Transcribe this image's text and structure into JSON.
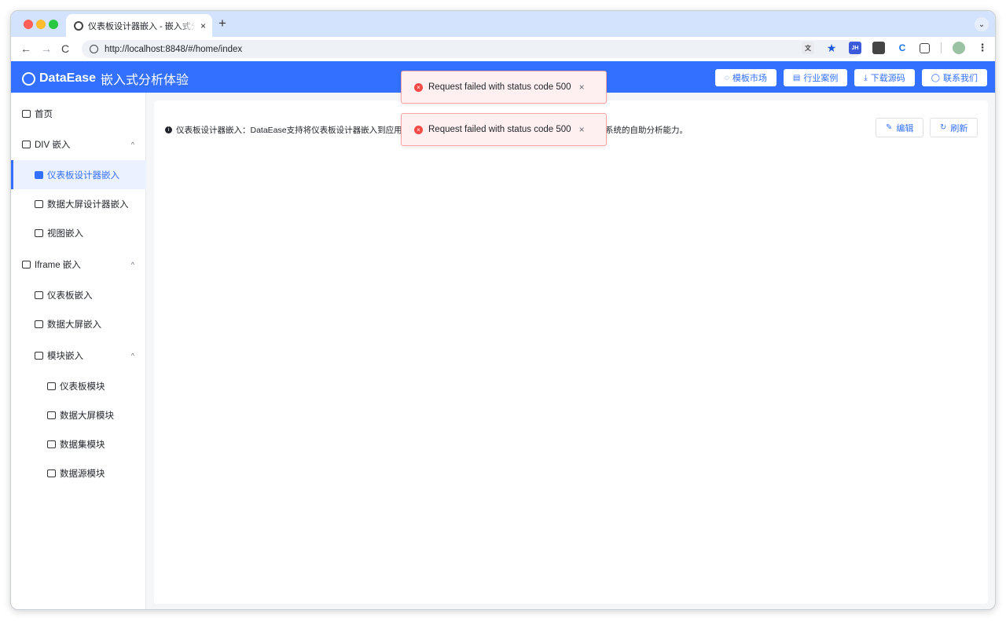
{
  "browser": {
    "tab_title": "仪表板设计器嵌入 - 嵌入式分析体验",
    "tab_close": "×",
    "new_tab": "+",
    "tab_menu": "⌄",
    "nav_back": "←",
    "nav_forward": "→",
    "nav_reload": "C",
    "url": "http://localhost:8848/#/home/index",
    "ext_jh": "JH",
    "ext_c": "C",
    "star": "★",
    "more": "⋮"
  },
  "header": {
    "brand_name": "DataEase",
    "brand_sub": "嵌入式分析体验",
    "buttons": [
      {
        "label": "模板市场",
        "icon": "thumb-icon"
      },
      {
        "label": "行业案例",
        "icon": "document-icon"
      },
      {
        "label": "下载源码",
        "icon": "download-icon"
      },
      {
        "label": "联系我们",
        "icon": "chat-icon"
      }
    ],
    "accent": "#3370ff"
  },
  "sidebar": {
    "items": [
      {
        "label": "首页"
      },
      {
        "label": "DIV 嵌入"
      },
      {
        "label": "仪表板设计器嵌入"
      },
      {
        "label": "数据大屏设计器嵌入"
      },
      {
        "label": "视图嵌入"
      },
      {
        "label": "Iframe 嵌入"
      },
      {
        "label": "仪表板嵌入"
      },
      {
        "label": "数据大屏嵌入"
      },
      {
        "label": "模块嵌入"
      },
      {
        "label": "仪表板模块"
      },
      {
        "label": "数据大屏模块"
      },
      {
        "label": "数据集模块"
      },
      {
        "label": "数据源模块"
      }
    ],
    "chevron": "^"
  },
  "main": {
    "info_text": "仪表板设计器嵌入：DataEase支持将仪表板设计器嵌入到应用",
    "info_tail": "系统的自助分析能力。",
    "edit_label": "编辑",
    "refresh_label": "刷新"
  },
  "toasts": [
    {
      "message": "Request failed with status code 500",
      "close": "×"
    },
    {
      "message": "Request failed with status code 500",
      "close": "×"
    }
  ],
  "colors": {
    "error": "#f54a45",
    "accent": "#3370ff"
  }
}
